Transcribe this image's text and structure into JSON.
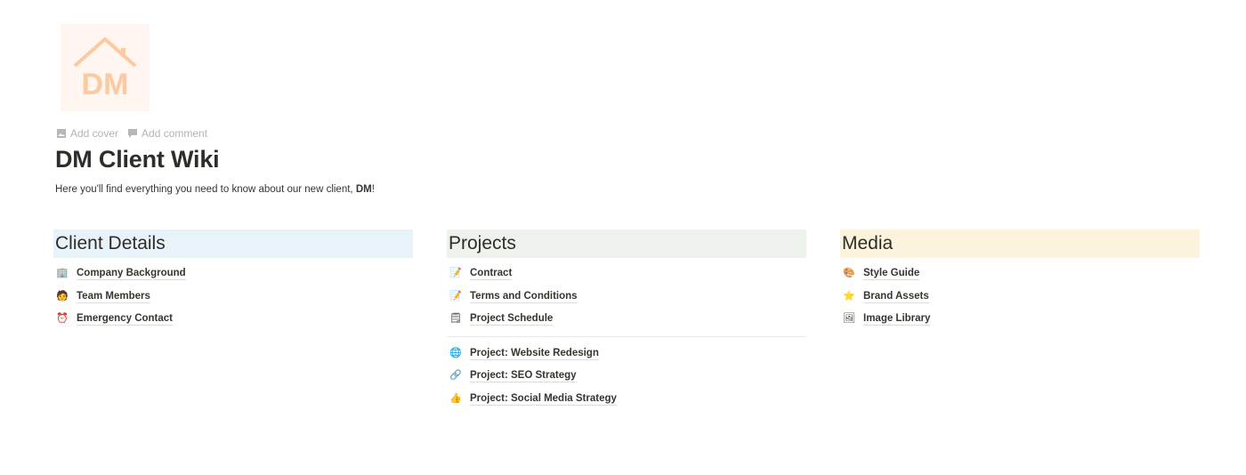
{
  "page": {
    "icon_text": "DM",
    "actions": [
      {
        "icon": "image-icon",
        "label": "Add cover"
      },
      {
        "icon": "comment-icon",
        "label": "Add comment"
      }
    ],
    "title": "DM Client Wiki",
    "intro_prefix": "Here you'll find everything you need to know about our new client, ",
    "intro_bold": "DM",
    "intro_suffix": "!"
  },
  "columns": [
    {
      "heading": "Client Details",
      "color": "#e7f3f8",
      "items": [
        {
          "icon": "office-building-icon",
          "glyph": "🏢",
          "label": "Company Background"
        },
        {
          "icon": "person-icon",
          "glyph": "🧑",
          "label": "Team Members"
        },
        {
          "icon": "alarm-clock-icon",
          "glyph": "⏰",
          "label": "Emergency Contact"
        }
      ]
    },
    {
      "heading": "Projects",
      "color": "#edf3ec",
      "items": [
        {
          "icon": "memo-icon",
          "glyph": "📝",
          "label": "Contract"
        },
        {
          "icon": "memo-icon",
          "glyph": "📝",
          "label": "Terms and Conditions"
        },
        {
          "icon": "notepad-icon",
          "glyph": "🗒",
          "label": "Project Schedule"
        }
      ],
      "items_after_divider": [
        {
          "icon": "globe-icon",
          "glyph": "🌐",
          "label": "Project: Website Redesign"
        },
        {
          "icon": "link-icon",
          "glyph": "🔗",
          "label": "Project: SEO Strategy"
        },
        {
          "icon": "thumbs-up-icon",
          "glyph": "👍",
          "label": "Project: Social Media Strategy"
        }
      ]
    },
    {
      "heading": "Media",
      "color": "#fbf3db",
      "items": [
        {
          "icon": "palette-icon",
          "glyph": "🎨",
          "label": "Style Guide"
        },
        {
          "icon": "star-icon",
          "glyph": "⭐",
          "label": "Brand Assets"
        },
        {
          "icon": "framed-picture-icon",
          "glyph": "🖼",
          "label": "Image Library"
        }
      ]
    }
  ]
}
